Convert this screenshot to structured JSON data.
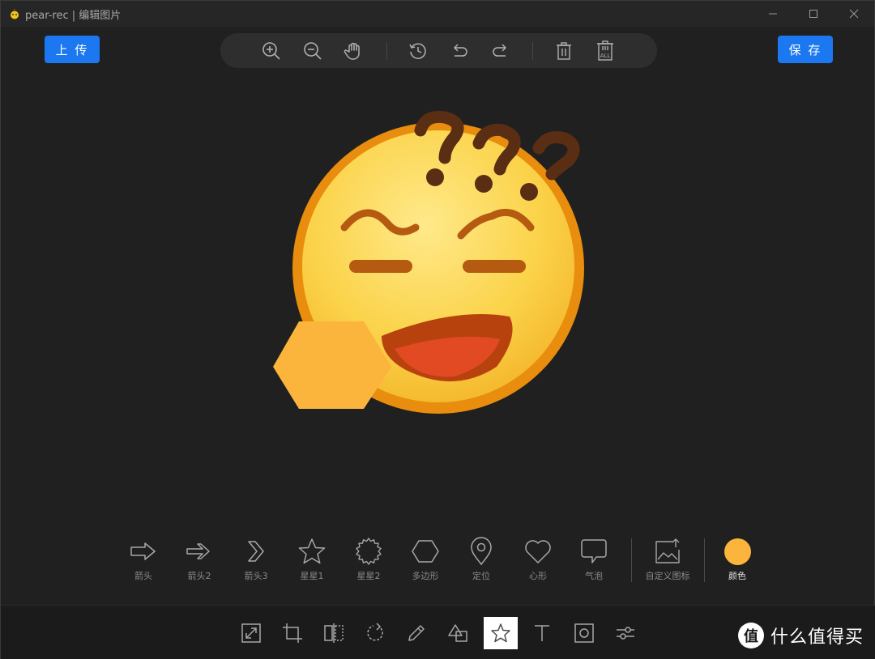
{
  "window": {
    "title": "pear-rec | 编辑图片",
    "controls": [
      "minimize-icon",
      "maximize-icon",
      "close-icon"
    ]
  },
  "header": {
    "upload_label": "上 传",
    "save_label": "保 存",
    "accent_color": "#1b78f0"
  },
  "top_toolbar": {
    "tools": [
      "zoom-in-icon",
      "zoom-out-icon",
      "pan-hand-icon",
      "history-icon",
      "undo-icon",
      "redo-icon",
      "delete-icon",
      "delete-all-icon"
    ],
    "delete_all_text": "ALL"
  },
  "shapes": {
    "items": [
      {
        "icon": "arrow-icon",
        "label": "箭头"
      },
      {
        "icon": "arrow-2-icon",
        "label": "箭头2"
      },
      {
        "icon": "arrow-3-icon",
        "label": "箭头3"
      },
      {
        "icon": "star-1-icon",
        "label": "星星1"
      },
      {
        "icon": "star-2-icon",
        "label": "星星2"
      },
      {
        "icon": "polygon-icon",
        "label": "多边形"
      },
      {
        "icon": "location-pin-icon",
        "label": "定位"
      },
      {
        "icon": "heart-icon",
        "label": "心形"
      },
      {
        "icon": "speech-bubble-icon",
        "label": "气泡"
      }
    ],
    "custom": {
      "icon": "custom-image-icon",
      "label": "自定义图标"
    },
    "color": {
      "label": "颜色",
      "value": "#fbb43c"
    }
  },
  "bottom_toolbar": {
    "tools": [
      "resize-icon",
      "crop-icon",
      "flip-icon",
      "rotate-icon",
      "pen-icon",
      "shapes-icon",
      "star-sticker-icon",
      "text-icon",
      "frame-icon",
      "adjust-icon"
    ],
    "active": "star-sticker-icon"
  },
  "watermark": {
    "badge": "值",
    "text": "什么值得买"
  }
}
